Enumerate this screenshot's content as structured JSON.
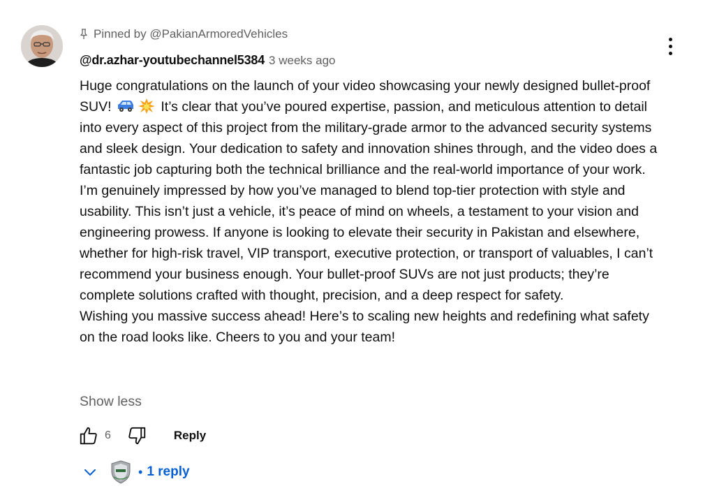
{
  "comment": {
    "pinned_text": "Pinned by @PakianArmoredVehicles",
    "author": "@dr.azhar-youtubechannel5384",
    "timestamp": "3 weeks ago",
    "body_part1": "Huge congratulations on the launch of your video showcasing your newly designed bullet-proof SUV!",
    "emojis": [
      "suv-emoji",
      "collision-emoji"
    ],
    "body_part2": "It’s clear that you’ve poured expertise, passion, and meticulous attention to detail into every aspect of this project from the military-grade armor to the advanced security systems and sleek design. Your dedication to safety and innovation shines through, and the video does a fantastic job capturing both the technical brilliance and the real-world importance of your work. I’m genuinely impressed by how you’ve managed to blend top-tier protection with style and usability. This isn’t just a vehicle, it’s peace of mind on wheels, a testament to your vision and engineering prowess. If anyone is looking to elevate their security in Pakistan and elsewhere, whether for high-risk travel, VIP transport, executive protection, or transport of valuables, I can’t recommend your business enough. Your bullet-proof SUVs are not just products; they’re complete solutions crafted with thought, precision, and a deep respect for safety.",
    "body_part3": "Wishing you massive success ahead! Here’s to scaling new heights and redefining what safety on the road looks like. Cheers to you and your team!",
    "show_less_label": "Show less",
    "like_count": "6",
    "reply_label": "Reply",
    "reply_bullet": "•",
    "reply_count_label": "1 reply"
  },
  "icons": {
    "pin": "pin-icon",
    "menu": "more-vert-icon",
    "like": "thumbs-up-icon",
    "dislike": "thumbs-down-icon",
    "expand": "chevron-down-icon"
  },
  "colors": {
    "text_primary": "#0f0f0f",
    "text_secondary": "#606060",
    "link_blue": "#065fd4",
    "background": "#ffffff"
  }
}
